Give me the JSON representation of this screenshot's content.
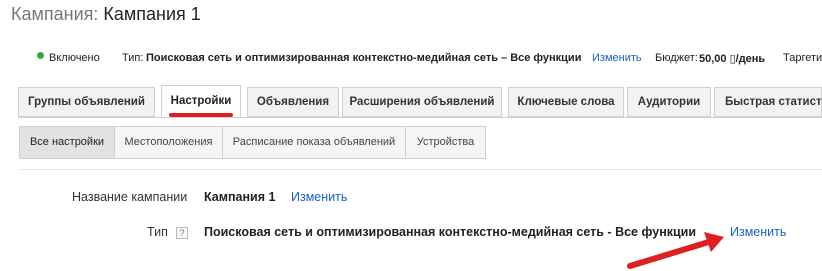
{
  "header": {
    "prefix": "Кампания:",
    "campaign_name": "Кампания 1"
  },
  "status_bar": {
    "status_color": "#3ba63b",
    "status_text": "Включено",
    "type_label": "Тип:",
    "type_value": "Поисковая сеть и оптимизированная контекстно-медийная сеть – Все функции",
    "type_edit_link": "Изменить",
    "budget_label": "Бюджет:",
    "budget_value": "50,00 ▯/день",
    "targeting_label": "Таргети"
  },
  "tabs": [
    {
      "label": "Группы объявлений",
      "active": false
    },
    {
      "label": "Настройки",
      "active": true
    },
    {
      "label": "Объявления",
      "active": false
    },
    {
      "label": "Расширения объявлений",
      "active": false
    },
    {
      "label": "Ключевые слова",
      "active": false
    },
    {
      "label": "Аудитории",
      "active": false
    },
    {
      "label": "Быстрая статисти",
      "active": false
    }
  ],
  "subtabs": [
    {
      "label": "Все настройки",
      "active": true
    },
    {
      "label": "Местоположения",
      "active": false
    },
    {
      "label": "Расписание показа объявлений",
      "active": false
    },
    {
      "label": "Устройства",
      "active": false
    }
  ],
  "settings": {
    "campaign_name_label": "Название кампании",
    "campaign_name_value": "Кампания 1",
    "campaign_name_edit": "Изменить",
    "type_label": "Тип",
    "help_icon_glyph": "?",
    "type_value": "Поисковая сеть и оптимизированная контекстно-медийная сеть - Все функции",
    "type_edit": "Изменить"
  },
  "colors": {
    "link": "#1a5fc7",
    "accent_red": "#e02020"
  }
}
